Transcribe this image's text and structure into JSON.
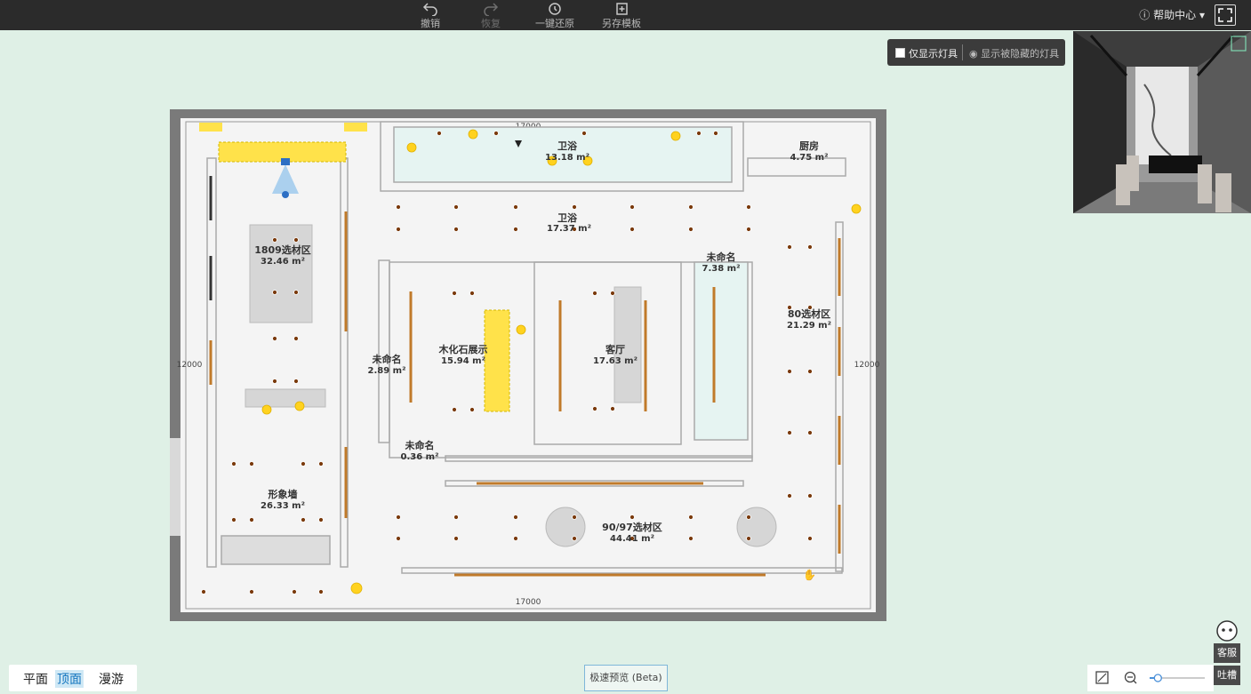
{
  "toolbar": {
    "undo": "撤销",
    "redo": "恢复",
    "restore": "一键还原",
    "save_template": "另存模板",
    "help": "帮助中心"
  },
  "light_panel": {
    "only_show_lights": "仅显示灯具",
    "show_hidden_lights": "显示被隐藏的灯具"
  },
  "plan": {
    "dim_top": "17000",
    "dim_bottom": "17000",
    "dim_left": "12000",
    "dim_right": "12000",
    "rooms": [
      {
        "name": "卫浴",
        "area": "13.18 m²"
      },
      {
        "name": "厨房",
        "area": "4.75 m²"
      },
      {
        "name": "卫浴",
        "area": "17.37 m²"
      },
      {
        "name": "1809选材区",
        "area": "32.46 m²"
      },
      {
        "name": "未命名",
        "area": "7.38 m²"
      },
      {
        "name": "80选材区",
        "area": "21.29 m²"
      },
      {
        "name": "木化石展示",
        "area": "15.94 m²"
      },
      {
        "name": "客厅",
        "area": "17.63 m²"
      },
      {
        "name": "未命名",
        "area": "2.89 m²"
      },
      {
        "name": "未命名",
        "area": "0.36 m²"
      },
      {
        "name": "形象墙",
        "area": "26.33 m²"
      },
      {
        "name": "90/97选材区",
        "area": "44.41 m²"
      }
    ]
  },
  "view_modes": {
    "plan": "平面",
    "ceiling": "顶面",
    "roam": "漫游"
  },
  "fast_preview": "极速预览 (Beta)",
  "service": {
    "support": "客服",
    "feedback": "吐槽"
  },
  "zoom": {
    "level": 0.15
  }
}
